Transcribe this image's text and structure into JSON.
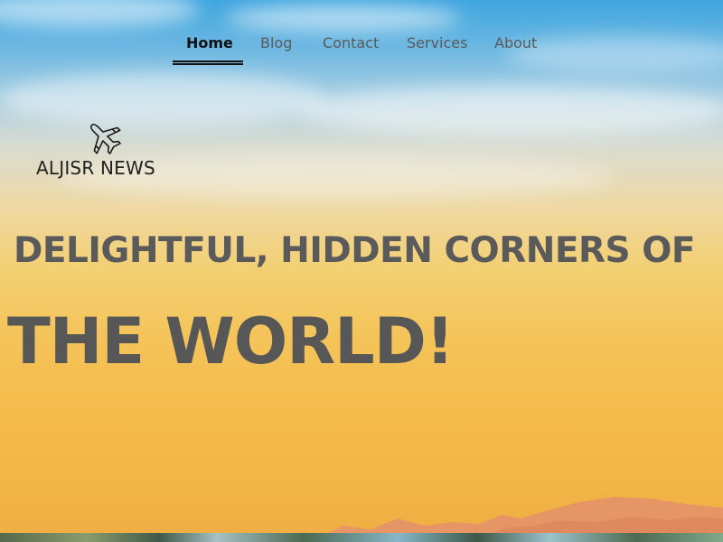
{
  "nav": {
    "items": [
      {
        "label": "Home",
        "active": true
      },
      {
        "label": "Blog",
        "active": false
      },
      {
        "label": "Contact",
        "active": false
      },
      {
        "label": "Services",
        "active": false
      },
      {
        "label": "About",
        "active": false
      }
    ]
  },
  "logo": {
    "icon": "airplane-icon",
    "text": "ALJISR NEWS"
  },
  "hero": {
    "headline_line1": "DELIGHTFUL, HIDDEN CORNERS OF",
    "headline_line2": "THE WORLD!"
  },
  "colors": {
    "sky_top": "#3fa6df",
    "sunset": "#f4bb4b",
    "headline_text": "#5a5a5a",
    "nav_active": "#111111",
    "nav_inactive": "#5a5a5a",
    "mountains": "#e69565"
  }
}
